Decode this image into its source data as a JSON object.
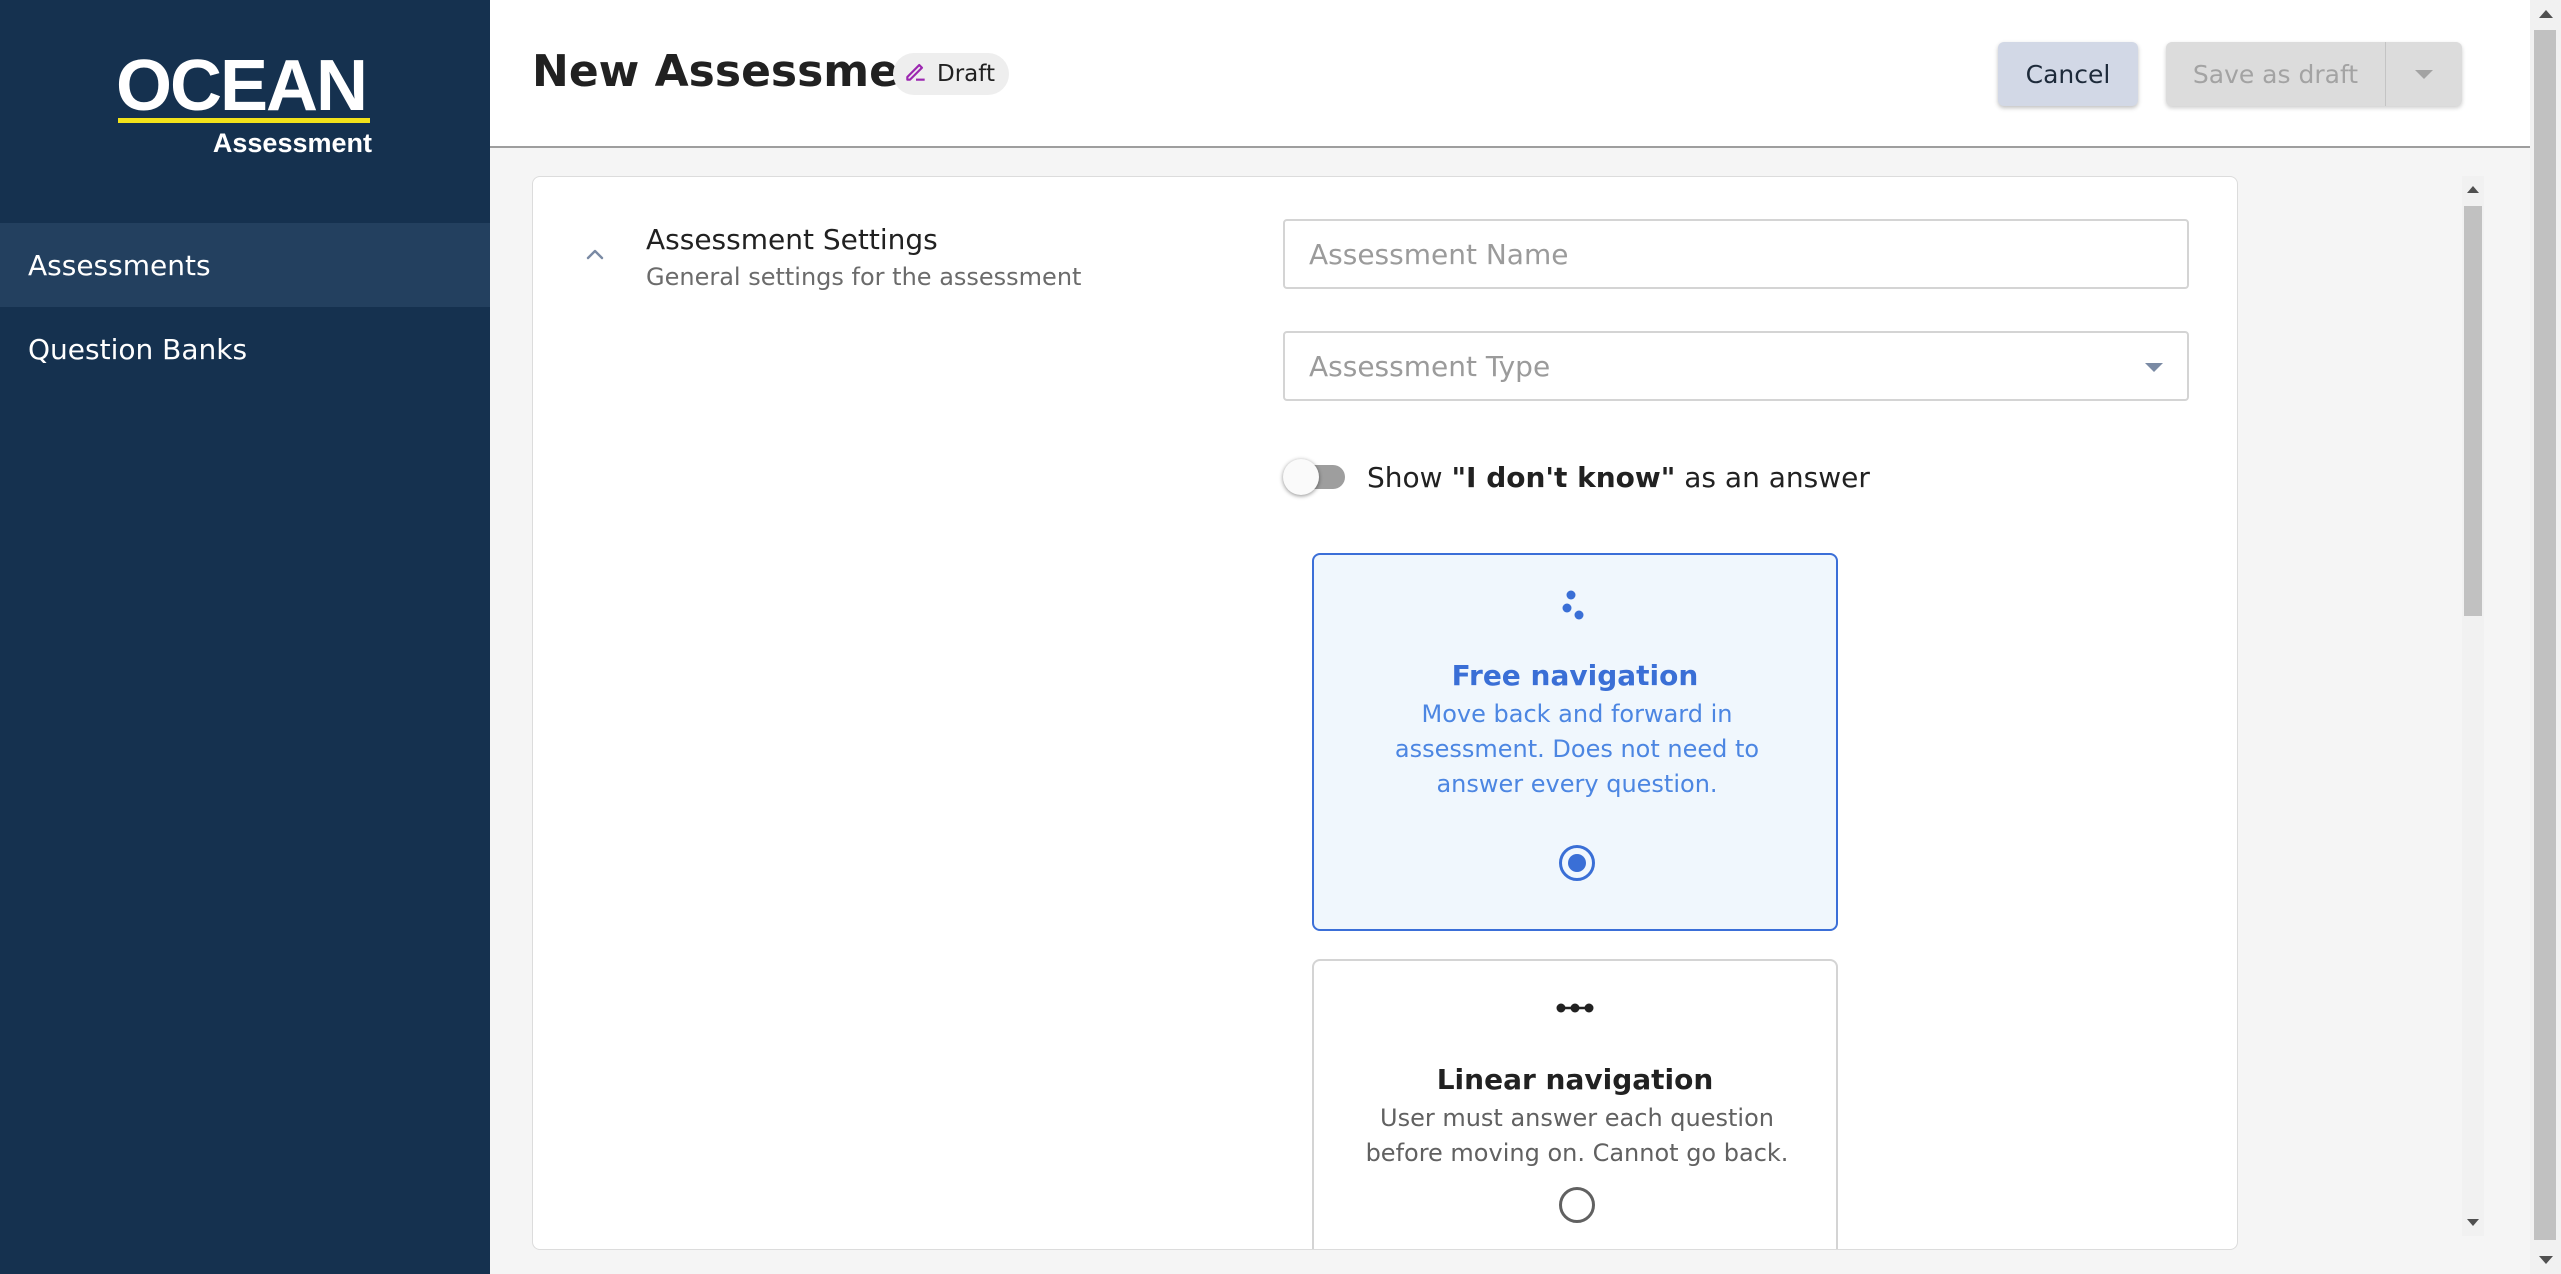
{
  "brand": {
    "logo_word": "OCEAN",
    "logo_sub": "Assessment",
    "accent": "#f2e21b"
  },
  "sidebar": {
    "items": [
      {
        "label": "Assessments",
        "active": true
      },
      {
        "label": "Question Banks",
        "active": false
      }
    ]
  },
  "header": {
    "title": "New Assessment",
    "status_chip": "Draft",
    "status_icon": "pencil-edit-icon",
    "cancel_label": "Cancel",
    "save_label": "Save as draft",
    "split_icon": "caret-down-icon"
  },
  "settings": {
    "title": "Assessment Settings",
    "subtitle": "General settings for the assessment",
    "name_field": {
      "placeholder": "Assessment Name",
      "value": ""
    },
    "type_field": {
      "placeholder": "Assessment Type",
      "value": ""
    },
    "idk_toggle": {
      "prefix": "Show ",
      "emphasis": "\"I don't know\"",
      "suffix": " as an answer",
      "on": false
    },
    "navigation_options": [
      {
        "title": "Free navigation",
        "description": "Move back and forward in assessment. Does not need to answer every question.",
        "icon": "scatter-dots-icon",
        "selected": true
      },
      {
        "title": "Linear navigation",
        "description": "User must answer each question before moving on. Cannot go back.",
        "icon": "linear-dots-icon",
        "selected": false
      }
    ]
  },
  "colors": {
    "sidebar_bg": "#15314f",
    "sidebar_active": "#23405f",
    "primary": "#3a6fd6",
    "selected_card_bg": "#f0f7fd"
  }
}
